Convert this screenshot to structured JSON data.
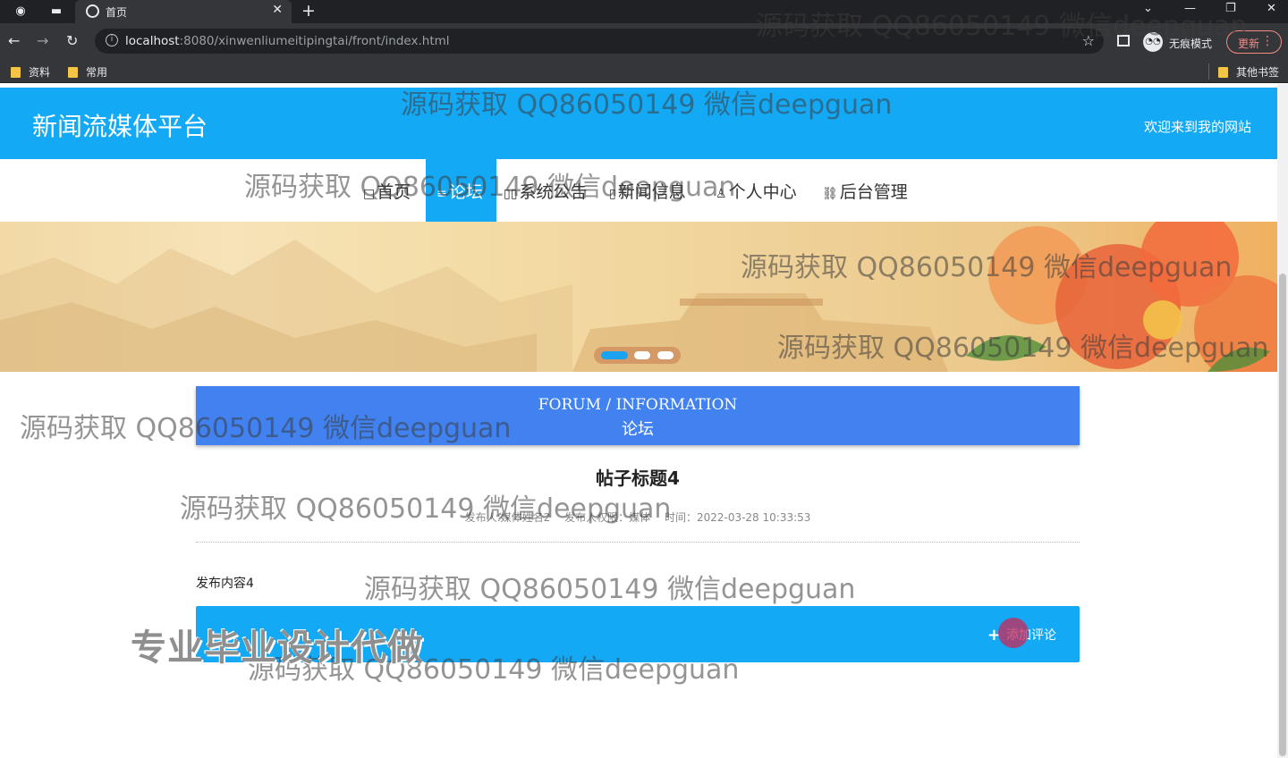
{
  "browser": {
    "tab_title": "首页",
    "url_host": "localhost",
    "url_rest": ":8080/xinwenliumeitipingtai/front/index.html",
    "incognito_label": "无痕模式",
    "update_label": "更新",
    "bookmarks": [
      "资料",
      "常用"
    ],
    "other_bookmarks": "其他书签"
  },
  "site": {
    "title": "新闻流媒体平台",
    "welcome": "欢迎来到我的网站"
  },
  "nav": {
    "items": [
      {
        "icon": "home-icon",
        "glyph": "□",
        "label": "首页"
      },
      {
        "icon": "forum-icon",
        "glyph": "≡",
        "label": "论坛"
      },
      {
        "icon": "notice-icon",
        "glyph": "▯▯",
        "label": "系统公告"
      },
      {
        "icon": "news-icon",
        "glyph": "▯",
        "label": "新闻信息"
      },
      {
        "icon": "user-icon",
        "glyph": "♙",
        "label": "个人中心"
      },
      {
        "icon": "link-icon",
        "glyph": "⛓",
        "label": "后台管理"
      }
    ],
    "active_index": 1
  },
  "banner": {
    "slides": 3,
    "active_slide": 0
  },
  "section": {
    "en": "FORUM / INFORMATION",
    "zh": "论坛"
  },
  "post": {
    "title": "帖子标题4",
    "author": "发布人:媒体姓名2",
    "role": "发布人权限：媒体",
    "time": "时间：2022-03-28 10:33:53",
    "content": "发布内容4"
  },
  "actions": {
    "comment_label": "添加评论"
  },
  "overlays": {
    "watermark": "源码获取 QQ86050149 微信deepguan",
    "promo": "专业毕业设计代做"
  },
  "colors": {
    "primary": "#14a9f5",
    "section_banner": "#4181f0",
    "browser_dark": "#202124"
  }
}
